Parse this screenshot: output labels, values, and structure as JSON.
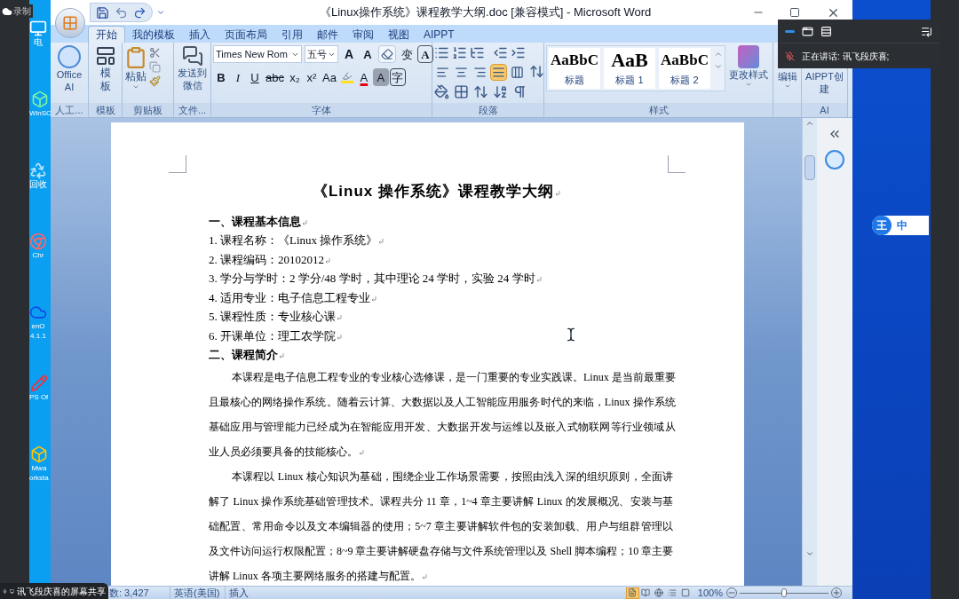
{
  "recording": {
    "label": "录制"
  },
  "desktop_icons": [
    {
      "kind": "pc",
      "label": "电"
    },
    {
      "kind": "app",
      "label": "WinSC"
    },
    {
      "kind": "bin",
      "label": "回收"
    },
    {
      "kind": "chrome",
      "label": "Chr"
    },
    {
      "kind": "office",
      "label": "enO",
      "sublabel": "4.1.1"
    },
    {
      "kind": "wps",
      "label": "PS Of"
    },
    {
      "kind": "vm",
      "label": "Mwa",
      "sublabel": "orksta"
    }
  ],
  "window": {
    "title": "《Linux操作系统》课程教学大纲.doc [兼容模式] - Microsoft Word"
  },
  "tabs": [
    {
      "label": "开始",
      "selected": true
    },
    {
      "label": "我的模板",
      "selected": false
    },
    {
      "label": "插入",
      "selected": false
    },
    {
      "label": "页面布局",
      "selected": false
    },
    {
      "label": "引用",
      "selected": false
    },
    {
      "label": "邮件",
      "selected": false
    },
    {
      "label": "审阅",
      "selected": false
    },
    {
      "label": "视图",
      "selected": false
    },
    {
      "label": "AIPPT",
      "selected": false
    }
  ],
  "ribbon": {
    "ai": {
      "label": "Office AI",
      "group": "人工..."
    },
    "template": {
      "label": "模板",
      "group": "模板"
    },
    "clipboard": {
      "paste": "粘贴",
      "group": "剪贴板"
    },
    "file": {
      "label": "发送到微信",
      "group": "文件..."
    },
    "font": {
      "name": "Times New Rom",
      "size": "五号",
      "group": "字体",
      "row1": [
        {
          "kind": "grow",
          "label": "A"
        },
        {
          "kind": "shrink",
          "label": "A"
        },
        {
          "kind": "clear"
        },
        {
          "kind": "phonetic",
          "label": "变"
        },
        {
          "kind": "border",
          "label": "A"
        }
      ],
      "row2": [
        {
          "kind": "bold",
          "label": "B"
        },
        {
          "kind": "italic",
          "label": "I"
        },
        {
          "kind": "underline",
          "label": "U"
        },
        {
          "kind": "strike",
          "label": "abc"
        },
        {
          "kind": "sub",
          "label": "x₂"
        },
        {
          "kind": "sup",
          "label": "x²"
        },
        {
          "kind": "case",
          "label": "Aa"
        },
        {
          "kind": "highlight"
        },
        {
          "kind": "color",
          "label": "A"
        },
        {
          "kind": "shade",
          "label": "A"
        },
        {
          "kind": "enclose",
          "label": "字"
        }
      ]
    },
    "paragraph": {
      "group": "段落",
      "alignments": [
        {
          "kind": "left",
          "selected": false
        },
        {
          "kind": "center",
          "selected": false
        },
        {
          "kind": "right",
          "selected": false
        },
        {
          "kind": "justify",
          "selected": true
        },
        {
          "kind": "distribute",
          "selected": false
        }
      ]
    },
    "styles": {
      "group": "样式",
      "change": "更改样式",
      "items": [
        {
          "sample": "AaBbC",
          "name": "标题",
          "kind": "normal"
        },
        {
          "sample": "AaB",
          "name": "标题 1",
          "kind": "large"
        },
        {
          "sample": "AaBbC",
          "name": "标题 2",
          "kind": "normal"
        }
      ]
    },
    "editing": {
      "label": "编辑"
    },
    "aippt": {
      "label": "AIPPT创建",
      "group": "AI"
    }
  },
  "document": {
    "title": "《Linux 操作系统》课程教学大纲",
    "blocks": [
      {
        "kind": "heading",
        "text": "一、课程基本信息"
      },
      {
        "kind": "item",
        "text": "1. 课程名称：《Linux 操作系统》"
      },
      {
        "kind": "item",
        "text": "2. 课程编码：20102012"
      },
      {
        "kind": "item",
        "text": "3. 学分与学时：2 学分/48 学时，其中理论 24 学时，实验 24 学时"
      },
      {
        "kind": "item",
        "text": "4. 适用专业：电子信息工程专业"
      },
      {
        "kind": "item",
        "text": "5. 课程性质：专业核心课"
      },
      {
        "kind": "item",
        "text": "6. 开课单位：理工农学院"
      },
      {
        "kind": "heading",
        "text": "二、课程简介"
      },
      {
        "kind": "paragraph",
        "lines": [
          "本课程是电子信息工程专业的专业核心选修课，是一门重要的专业实践课。Linux 是当前最重要",
          "且最核心的网络操作系统。随着云计算、大数据以及人工智能应用服务时代的来临，Linux 操作系统",
          "基础应用与管理能力已经成为在智能应用开发、大数据开发与运维以及嵌入式物联网等行业领域从",
          "业人员必须要具备的技能核心。"
        ]
      },
      {
        "kind": "paragraph",
        "lines": [
          "本课程以 Linux 核心知识为基础，围绕企业工作场景需要，按照由浅入深的组织原则，全面讲",
          "解了 Linux 操作系统基础管理技术。课程共分 11 章，1~4 章主要讲解 Linux 的发展概况、安装与基",
          "础配置、常用命令以及文本编辑器的使用；5~7 章主要讲解软件包的安装卸载、用户与组群管理以",
          "及文件访问运行权限配置；8~9 章主要讲解硬盘存储与文件系统管理以及 Shell 脚本编程；10 章主要",
          "讲解 Linux 各项主要网络服务的搭建与配置。"
        ]
      }
    ]
  },
  "status_bar": {
    "word_count": "数: 3,427",
    "language": "英语(美国)",
    "mode": "插入",
    "views": [
      {
        "kind": "print",
        "selected": true
      },
      {
        "kind": "read",
        "selected": false
      },
      {
        "kind": "web",
        "selected": false
      },
      {
        "kind": "outline",
        "selected": false
      },
      {
        "kind": "draft",
        "selected": false
      }
    ],
    "zoom": "100%",
    "zoom_slider": {
      "level": 0.5
    }
  },
  "meeting_bar": {
    "speaking": "正在讲话:  讯飞段庆喜;"
  },
  "share_banner": {
    "text": "讯飞段庆喜的屏幕共享"
  },
  "ime_badge": {
    "logo": "王",
    "mode": "中"
  }
}
